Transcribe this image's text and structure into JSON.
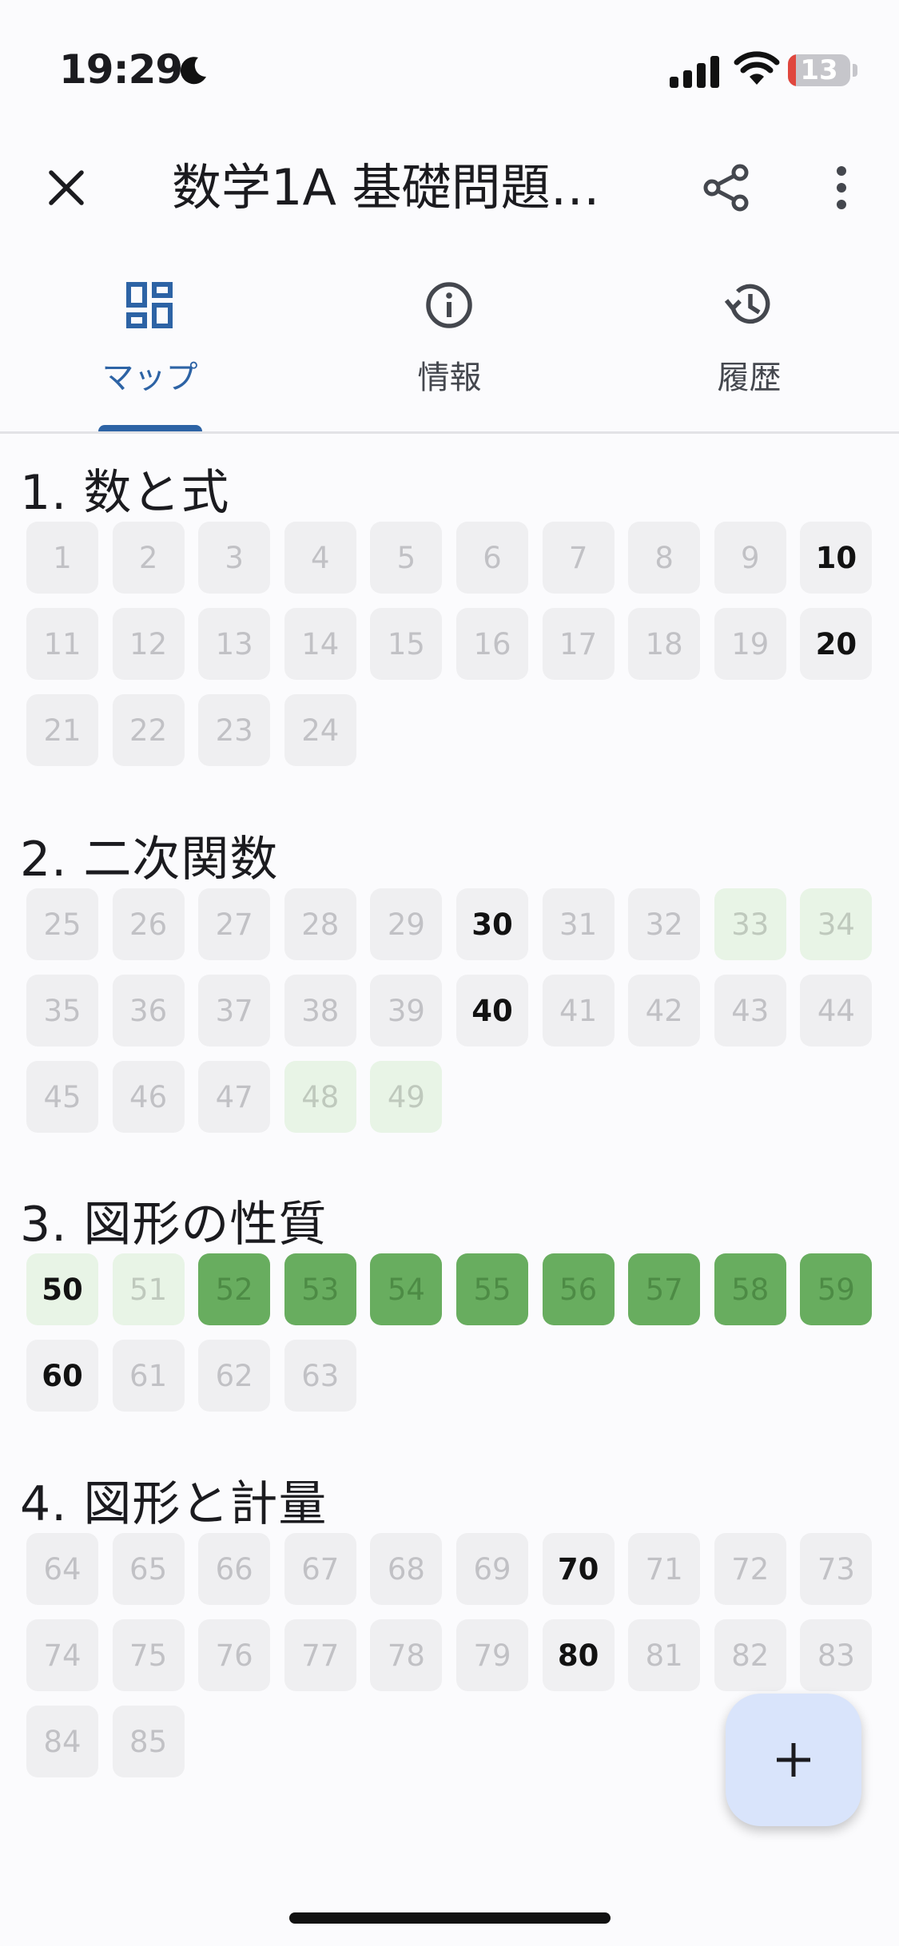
{
  "status_bar": {
    "time": "19:29",
    "battery": "13",
    "battery_level": 0.13
  },
  "app_bar": {
    "title": "数学1A 基礎問題…"
  },
  "tabs": [
    {
      "label": "マップ",
      "icon": "grid-map-icon",
      "active": true
    },
    {
      "label": "情報",
      "icon": "info-icon",
      "active": false
    },
    {
      "label": "履歴",
      "icon": "history-icon",
      "active": false
    }
  ],
  "colors": {
    "accent": "#2d63a5",
    "done": "#68ad5f",
    "partial": "#e8f4e6",
    "empty": "#efeff1"
  },
  "sections": [
    {
      "title": "1. 数と式",
      "cells": [
        {
          "n": "1",
          "state": "empty"
        },
        {
          "n": "2",
          "state": "empty"
        },
        {
          "n": "3",
          "state": "empty"
        },
        {
          "n": "4",
          "state": "empty"
        },
        {
          "n": "5",
          "state": "empty"
        },
        {
          "n": "6",
          "state": "empty"
        },
        {
          "n": "7",
          "state": "empty"
        },
        {
          "n": "8",
          "state": "empty"
        },
        {
          "n": "9",
          "state": "empty"
        },
        {
          "n": "10",
          "state": "empty",
          "bold": true
        },
        {
          "n": "11",
          "state": "empty"
        },
        {
          "n": "12",
          "state": "empty"
        },
        {
          "n": "13",
          "state": "empty"
        },
        {
          "n": "14",
          "state": "empty"
        },
        {
          "n": "15",
          "state": "empty"
        },
        {
          "n": "16",
          "state": "empty"
        },
        {
          "n": "17",
          "state": "empty"
        },
        {
          "n": "18",
          "state": "empty"
        },
        {
          "n": "19",
          "state": "empty"
        },
        {
          "n": "20",
          "state": "empty",
          "bold": true
        },
        {
          "n": "21",
          "state": "empty"
        },
        {
          "n": "22",
          "state": "empty"
        },
        {
          "n": "23",
          "state": "empty"
        },
        {
          "n": "24",
          "state": "empty"
        }
      ]
    },
    {
      "title": "2. 二次関数",
      "cells": [
        {
          "n": "25",
          "state": "empty"
        },
        {
          "n": "26",
          "state": "empty"
        },
        {
          "n": "27",
          "state": "empty"
        },
        {
          "n": "28",
          "state": "empty"
        },
        {
          "n": "29",
          "state": "empty"
        },
        {
          "n": "30",
          "state": "empty",
          "bold": true
        },
        {
          "n": "31",
          "state": "empty"
        },
        {
          "n": "32",
          "state": "empty"
        },
        {
          "n": "33",
          "state": "partial"
        },
        {
          "n": "34",
          "state": "partial"
        },
        {
          "n": "35",
          "state": "empty"
        },
        {
          "n": "36",
          "state": "empty"
        },
        {
          "n": "37",
          "state": "empty"
        },
        {
          "n": "38",
          "state": "empty"
        },
        {
          "n": "39",
          "state": "empty"
        },
        {
          "n": "40",
          "state": "empty",
          "bold": true
        },
        {
          "n": "41",
          "state": "empty"
        },
        {
          "n": "42",
          "state": "empty"
        },
        {
          "n": "43",
          "state": "empty"
        },
        {
          "n": "44",
          "state": "empty"
        },
        {
          "n": "45",
          "state": "empty"
        },
        {
          "n": "46",
          "state": "empty"
        },
        {
          "n": "47",
          "state": "empty"
        },
        {
          "n": "48",
          "state": "partial"
        },
        {
          "n": "49",
          "state": "partial"
        }
      ]
    },
    {
      "title": "3. 図形の性質",
      "cells": [
        {
          "n": "50",
          "state": "partial",
          "bold": true
        },
        {
          "n": "51",
          "state": "partial"
        },
        {
          "n": "52",
          "state": "done"
        },
        {
          "n": "53",
          "state": "done"
        },
        {
          "n": "54",
          "state": "done"
        },
        {
          "n": "55",
          "state": "done"
        },
        {
          "n": "56",
          "state": "done"
        },
        {
          "n": "57",
          "state": "done"
        },
        {
          "n": "58",
          "state": "done"
        },
        {
          "n": "59",
          "state": "done"
        },
        {
          "n": "60",
          "state": "empty",
          "bold": true
        },
        {
          "n": "61",
          "state": "empty"
        },
        {
          "n": "62",
          "state": "empty"
        },
        {
          "n": "63",
          "state": "empty"
        }
      ]
    },
    {
      "title": "4. 図形と計量",
      "cells": [
        {
          "n": "64",
          "state": "empty"
        },
        {
          "n": "65",
          "state": "empty"
        },
        {
          "n": "66",
          "state": "empty"
        },
        {
          "n": "67",
          "state": "empty"
        },
        {
          "n": "68",
          "state": "empty"
        },
        {
          "n": "69",
          "state": "empty"
        },
        {
          "n": "70",
          "state": "empty",
          "bold": true
        },
        {
          "n": "71",
          "state": "empty"
        },
        {
          "n": "72",
          "state": "empty"
        },
        {
          "n": "73",
          "state": "empty"
        },
        {
          "n": "74",
          "state": "empty"
        },
        {
          "n": "75",
          "state": "empty"
        },
        {
          "n": "76",
          "state": "empty"
        },
        {
          "n": "77",
          "state": "empty"
        },
        {
          "n": "78",
          "state": "empty"
        },
        {
          "n": "79",
          "state": "empty"
        },
        {
          "n": "80",
          "state": "empty",
          "bold": true
        },
        {
          "n": "81",
          "state": "empty"
        },
        {
          "n": "82",
          "state": "empty"
        },
        {
          "n": "83",
          "state": "empty"
        },
        {
          "n": "84",
          "state": "empty"
        },
        {
          "n": "85",
          "state": "empty"
        }
      ]
    }
  ],
  "fab": {
    "icon": "plus-icon"
  }
}
